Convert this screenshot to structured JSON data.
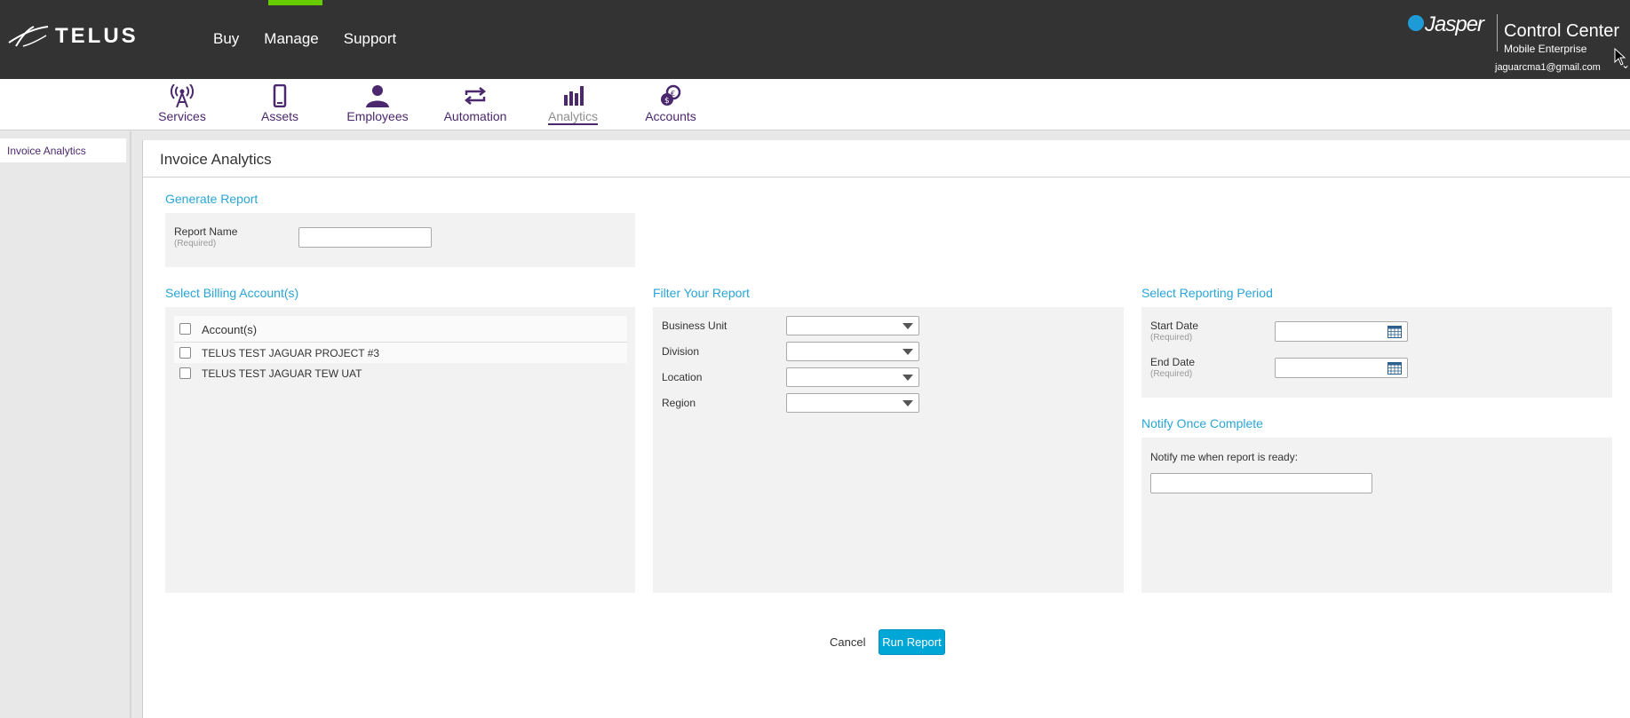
{
  "header": {
    "logo_text": "TELUS",
    "nav": [
      "Buy",
      "Manage",
      "Support"
    ],
    "brand_name": "Jasper",
    "product": "Control Center",
    "edition": "Mobile Enterprise",
    "user_email": "jaguarcma1@gmail.com",
    "accent_color": "#66cc00"
  },
  "icon_nav": {
    "items": [
      {
        "label": "Services",
        "icon": "antenna-icon"
      },
      {
        "label": "Assets",
        "icon": "phone-icon"
      },
      {
        "label": "Employees",
        "icon": "person-icon"
      },
      {
        "label": "Automation",
        "icon": "loop-arrows-icon"
      },
      {
        "label": "Analytics",
        "icon": "bar-chart-icon",
        "active": true
      },
      {
        "label": "Accounts",
        "icon": "coins-icon"
      }
    ],
    "color": "#4b286d"
  },
  "sidebar": {
    "items": [
      "Invoice Analytics"
    ]
  },
  "main": {
    "title": "Invoice Analytics",
    "generate_report": {
      "title": "Generate Report",
      "report_name_label": "Report Name",
      "required": "(Required)",
      "report_name_value": ""
    },
    "billing": {
      "title": "Select Billing Account(s)",
      "column": "Account(s)",
      "accounts": [
        "TELUS TEST JAGUAR PROJECT #3",
        "TELUS TEST JAGUAR TEW UAT"
      ]
    },
    "filter": {
      "title": "Filter Your Report",
      "fields": [
        "Business Unit",
        "Division",
        "Location",
        "Region"
      ]
    },
    "period": {
      "title": "Select Reporting Period",
      "start_label": "Start Date",
      "end_label": "End Date",
      "required": "(Required)"
    },
    "notify": {
      "title": "Notify Once Complete",
      "label": "Notify me when report is ready:",
      "value": ""
    },
    "actions": {
      "cancel": "Cancel",
      "run": "Run Report"
    }
  }
}
